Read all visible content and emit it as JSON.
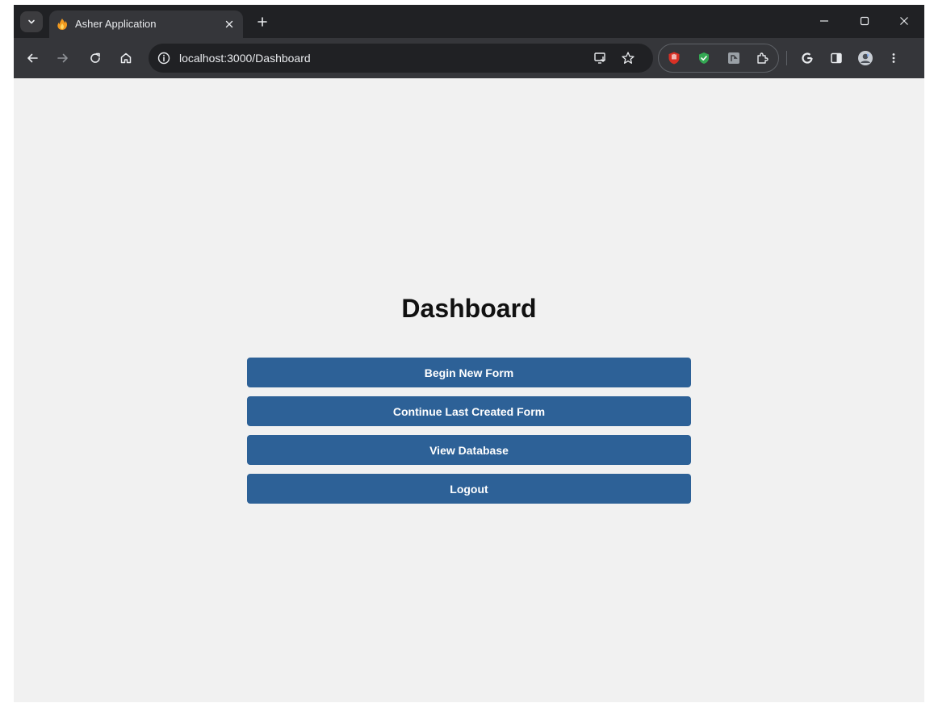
{
  "browser": {
    "tab": {
      "title": "Asher Application",
      "favicon": "fire-hand-icon"
    },
    "address_bar": {
      "url": "localhost:3000/Dashboard"
    },
    "icons": {
      "tab_search": "chevron-down-icon",
      "tab_close": "close-icon",
      "new_tab": "plus-icon",
      "minimize": "minimize-icon",
      "maximize": "maximize-icon",
      "close": "close-icon",
      "back": "back-arrow-icon",
      "forward": "forward-arrow-icon",
      "reload": "reload-icon",
      "home": "home-icon",
      "site_info": "info-icon",
      "install": "install-app-icon",
      "bookmark": "star-icon",
      "extensions": [
        "ublock-icon",
        "shield-check-icon",
        "extension-tile-icon",
        "puzzle-icon"
      ],
      "google": "google-icon",
      "side_panel": "side-panel-icon",
      "profile": "avatar-icon",
      "menu": "kebab-menu-icon"
    }
  },
  "dashboard": {
    "title": "Dashboard",
    "buttons": [
      {
        "label": "Begin New Form"
      },
      {
        "label": "Continue Last Created Form"
      },
      {
        "label": "View Database"
      },
      {
        "label": "Logout"
      }
    ]
  },
  "colors": {
    "page_background": "#f1f1f1",
    "button_background": "#2d6197",
    "button_text": "#ffffff",
    "chrome_dark": "#202124",
    "chrome_toolbar": "#35363a"
  }
}
